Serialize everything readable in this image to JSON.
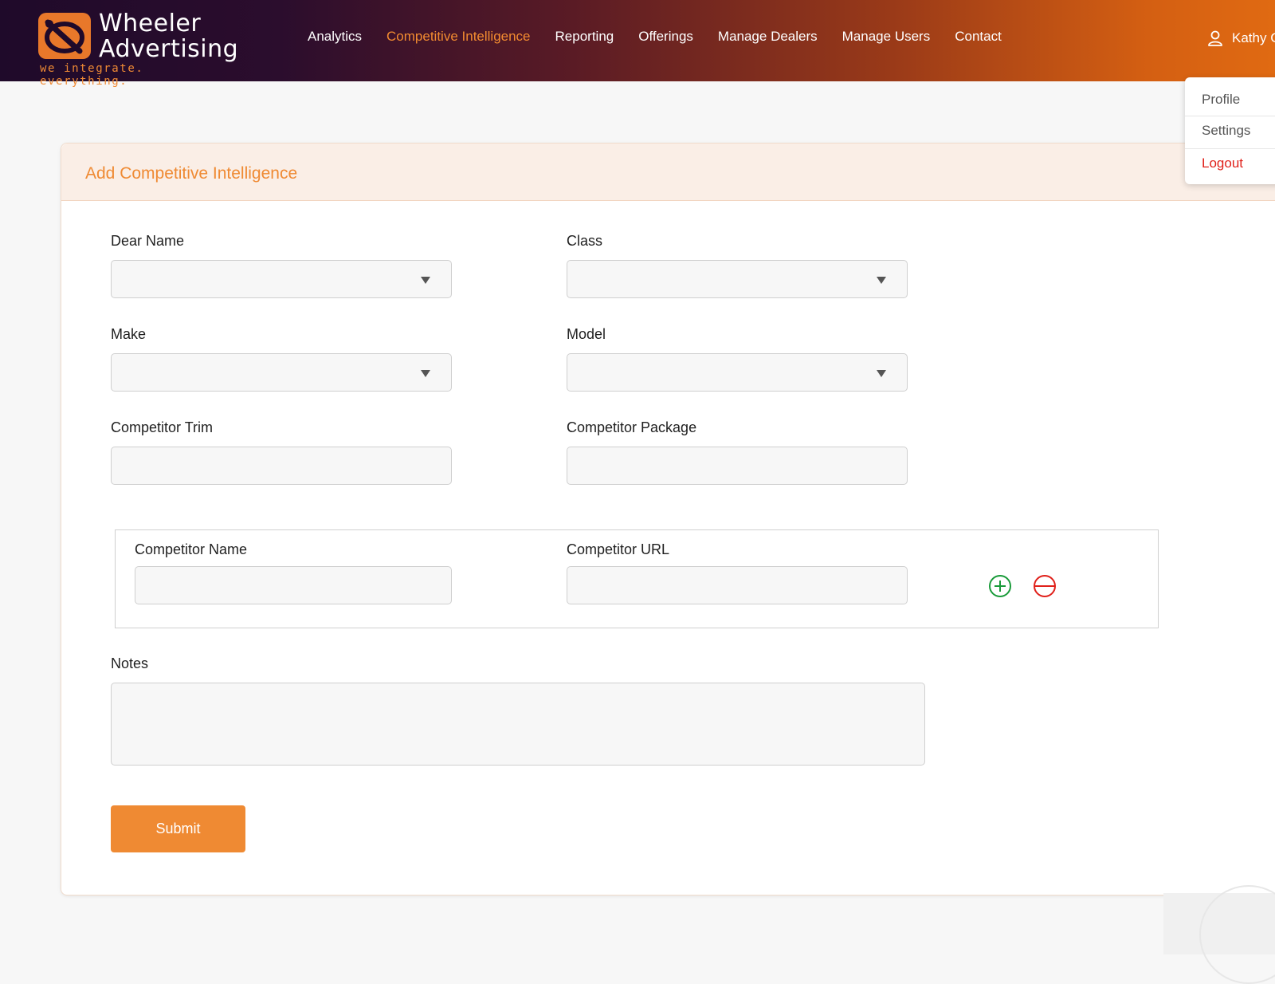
{
  "brand": {
    "name_line1": "Wheeler",
    "name_line2": "Advertising",
    "tagline": "we integrate. everything."
  },
  "nav": {
    "items": [
      {
        "label": "Analytics"
      },
      {
        "label": "Competitive Intelligence",
        "active": true
      },
      {
        "label": "Reporting"
      },
      {
        "label": "Offerings"
      },
      {
        "label": "Manage Dealers"
      },
      {
        "label": "Manage Users"
      },
      {
        "label": "Contact"
      }
    ]
  },
  "user": {
    "name": "Kathy G",
    "icon": "user-icon",
    "menu": {
      "profile": "Profile",
      "settings": "Settings",
      "logout": "Logout"
    }
  },
  "form": {
    "title": "Add Competitive Intelligence",
    "dealer_name": {
      "label": "Dear Name",
      "value": ""
    },
    "class": {
      "label": "Class",
      "value": ""
    },
    "make": {
      "label": "Make",
      "value": ""
    },
    "model": {
      "label": "Model",
      "value": ""
    },
    "competitor_trim": {
      "label": "Competitor Trim",
      "value": ""
    },
    "competitor_package": {
      "label": "Competitor Package",
      "value": ""
    },
    "competitor_name": {
      "label": "Competitor Name",
      "value": ""
    },
    "competitor_url": {
      "label": "Competitor URL",
      "value": ""
    },
    "notes": {
      "label": "Notes",
      "value": ""
    },
    "add_icon": "plus-circle-icon",
    "remove_icon": "minus-circle-icon",
    "submit_label": "Submit"
  },
  "colors": {
    "accent": "#ef8a33",
    "add": "#1a9b3a",
    "remove": "#e0201a",
    "logout": "#e0201a"
  }
}
